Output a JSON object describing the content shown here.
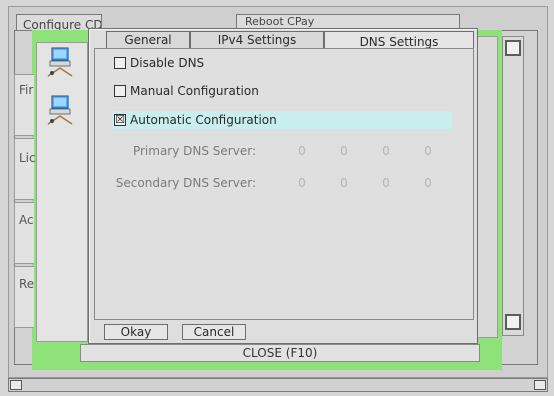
{
  "background": {
    "tabs": [
      {
        "label": "Configure CD"
      },
      {
        "label": "Reboot CPay"
      }
    ],
    "left_tabs": [
      {
        "label": "Fir"
      },
      {
        "label": "Lic"
      },
      {
        "label": "Ac"
      },
      {
        "label": "Re"
      }
    ],
    "close_button": "CLOSE (F10)"
  },
  "dialog": {
    "tabs": [
      {
        "label": "General",
        "active": false
      },
      {
        "label": "IPv4 Settings",
        "active": false
      },
      {
        "label": "DNS Settings",
        "active": true
      }
    ],
    "options": [
      {
        "label": "Disable DNS",
        "checked": false
      },
      {
        "label": "Manual Configuration",
        "checked": false
      },
      {
        "label": "Automatic Configuration",
        "checked": true,
        "check_mark": "☒"
      }
    ],
    "primary_dns": {
      "label": "Primary DNS Server:",
      "octets": [
        "0",
        "0",
        "0",
        "0"
      ]
    },
    "secondary_dns": {
      "label": "Secondary DNS Server:",
      "octets": [
        "0",
        "0",
        "0",
        "0"
      ]
    },
    "buttons": {
      "okay": "Okay",
      "cancel": "Cancel"
    }
  },
  "icons": [
    "network-computer-icon",
    "network-computer-icon"
  ],
  "colors": {
    "green": "#8fe27a",
    "highlight": "#c9eeee"
  }
}
